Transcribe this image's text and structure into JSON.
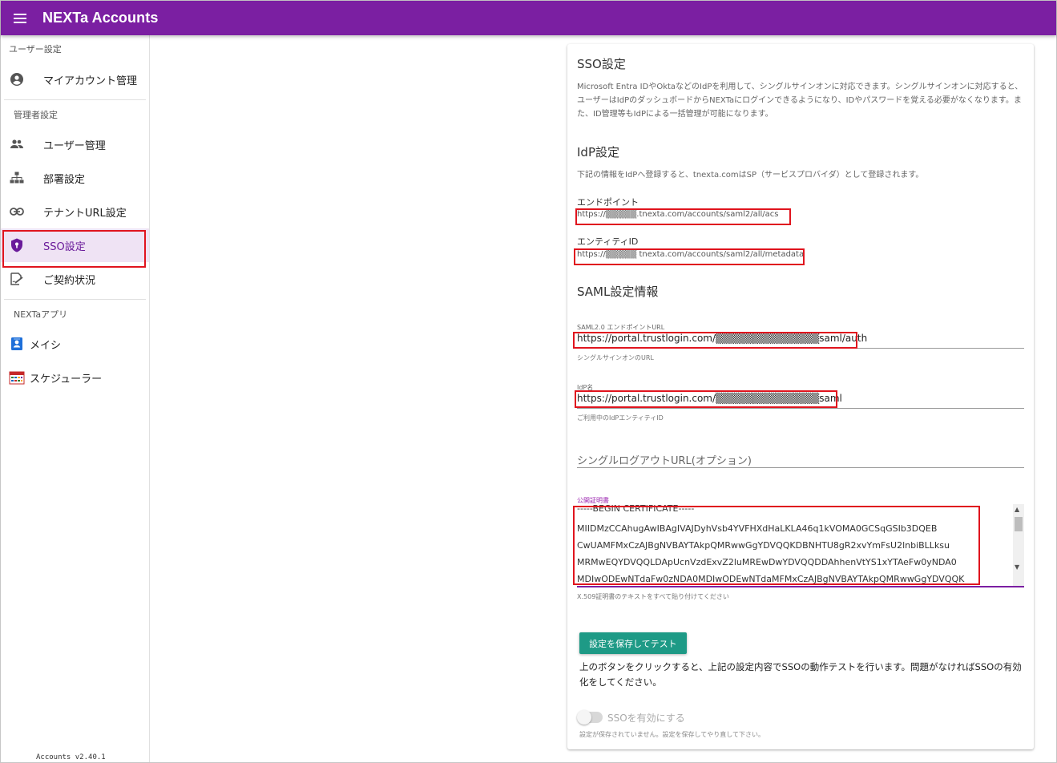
{
  "app": {
    "title": "NEXTa Accounts",
    "menu_icon": "hamburger-icon"
  },
  "sidebar": {
    "section_user": "ユーザー設定",
    "section_admin": "管理者設定",
    "section_apps": "NEXTaアプリ",
    "items": [
      {
        "label": "マイアカウント管理",
        "icon": "account-circle-icon"
      },
      {
        "label": "ユーザー管理",
        "icon": "people-icon"
      },
      {
        "label": "部署設定",
        "icon": "org-tree-icon"
      },
      {
        "label": "テナントURL設定",
        "icon": "link-icon"
      },
      {
        "label": "SSO設定",
        "icon": "shield-icon"
      },
      {
        "label": "ご契約状況",
        "icon": "contract-icon"
      }
    ],
    "apps": [
      {
        "label": "メイシ",
        "icon": "business-card-icon"
      },
      {
        "label": "スケジューラー",
        "icon": "calendar-icon"
      }
    ],
    "version": "Accounts v2.40.1"
  },
  "sso": {
    "title": "SSO設定",
    "description": "Microsoft Entra IDやOktaなどのIdPを利用して、シングルサインオンに対応できます。シングルサインオンに対応すると、ユーザーはIdPのダッシュボードからNEXTaにログインできるようになり、IDやパスワードを覚える必要がなくなります。また、ID管理等もIdPによる一括管理が可能になります。"
  },
  "idp": {
    "title": "IdP設定",
    "description": "下記の情報をIdPへ登録すると、tnexta.comはSP（サービスプロバイダ）として登録されます。",
    "endpoint_label": "エンドポイント",
    "endpoint_value": "https://▒▒▒▒▒.tnexta.com/accounts/saml2/all/acs",
    "entity_label": "エンティティID",
    "entity_value": "https://▒▒▒▒▒  tnexta.com/accounts/saml2/all/metadata"
  },
  "saml": {
    "title": "SAML設定情報",
    "endpoint_label": "SAML2.0 エンドポイントURL",
    "endpoint_value": "https://portal.trustlogin.com/▒▒▒▒▒▒▒▒▒▒▒▒▒▒saml/auth",
    "endpoint_hint": "シングルサインオンのURL",
    "idp_label": "IdP名",
    "idp_value": "https://portal.trustlogin.com/▒▒▒▒▒▒▒▒▒▒▒▒▒▒saml",
    "idp_hint": "ご利用中のIdPエンティティID",
    "logout_placeholder": "シングルログアウトURL(オプション)",
    "cert_label": "公開証明書",
    "cert_lines": [
      "-----BEGIN CERTIFICATE-----",
      "MIIDMzCCAhugAwIBAgIVAJDyhVsb4YVFHXdHaLKLA46q1kVOMA0GCSqGSIb3DQEB",
      "CwUAMFMxCzAJBgNVBAYTAkpQMRwwGgYDVQQKDBNHTU8gR2xvYmFsU2lnbiBLLksu",
      "MRMwEQYDVQQLDApUcnVzdExvZ2luMREwDwYDVQQDDAhhenVtYS1xYTAeFw0yNDA0",
      "MDIwODEwNTdaFw0zNDA0MDIwODEwNTdaMFMxCzAJBgNVBAYTAkpQMRwwGgYDVQQK"
    ],
    "cert_hint": "X.509証明書のテキストをすべて貼り付けてください"
  },
  "actions": {
    "save_test_label": "設定を保存してテスト",
    "save_test_description": "上のボタンをクリックすると、上記の設定内容でSSOの動作テストを行います。問題がなければSSOの有効化をしてください。",
    "enable_label": "SSOを有効にする",
    "enable_hint": "設定が保存されていません。設定を保存してやり直して下さい。",
    "enabled": false
  },
  "colors": {
    "appbar": "#7b1fa2",
    "active_bg": "#efe3f4",
    "button": "#1e9a86",
    "highlight": "#e0141e"
  }
}
